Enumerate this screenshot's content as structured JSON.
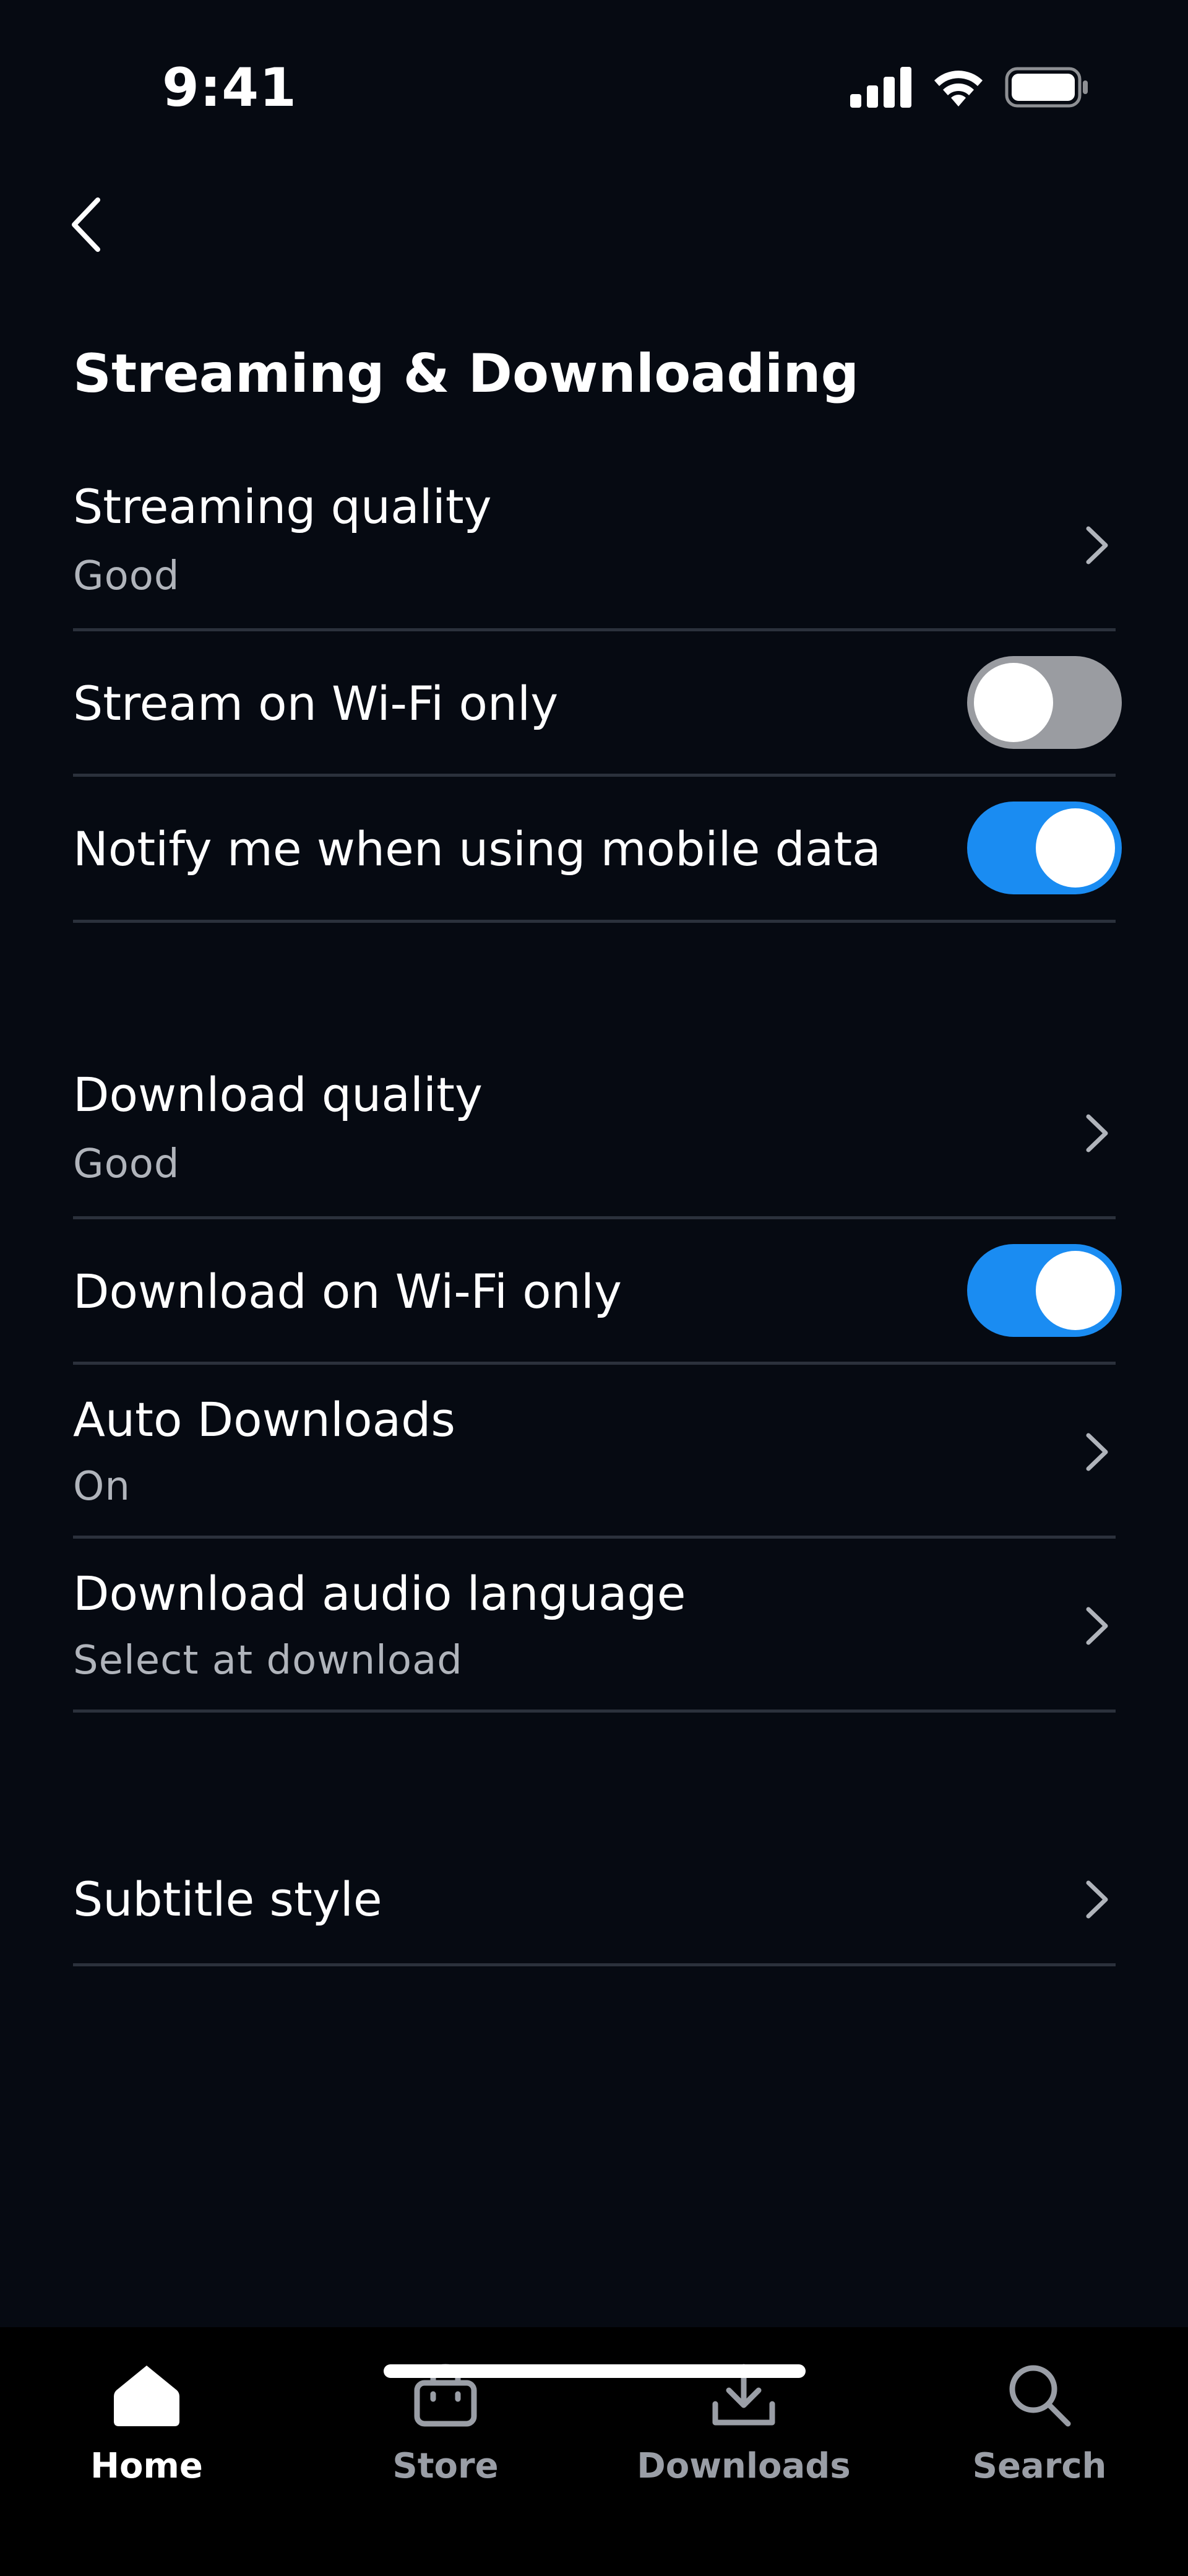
{
  "status_bar": {
    "time": "9:41"
  },
  "header": {
    "title": "Streaming & Downloading"
  },
  "streaming": {
    "quality_label": "Streaming quality",
    "quality_value": "Good",
    "wifi_only_label": "Stream on Wi-Fi only",
    "wifi_only_on": false,
    "notify_label": "Notify me when using mobile data",
    "notify_on": true
  },
  "downloads": {
    "quality_label": "Download quality",
    "quality_value": "Good",
    "wifi_only_label": "Download on Wi-Fi only",
    "wifi_only_on": true,
    "auto_label": "Auto Downloads",
    "auto_value": "On",
    "audio_language_label": "Download audio language",
    "audio_language_value": "Select at download"
  },
  "subtitles": {
    "style_label": "Subtitle style"
  },
  "nav": {
    "home": "Home",
    "store": "Store",
    "downloads": "Downloads",
    "search": "Search",
    "active": "home"
  },
  "colors": {
    "background": "#060a12",
    "toggle_on": "#1a8cf2",
    "toggle_off": "#9a9ca1",
    "divider": "#2b313c",
    "secondary_text": "#b0b4bb"
  },
  "icons": {
    "back": "chevron-left-icon",
    "row_chevron": "chevron-right-icon",
    "home": "home-icon",
    "store": "shopping-bag-icon",
    "downloads": "download-icon",
    "search": "search-icon"
  }
}
